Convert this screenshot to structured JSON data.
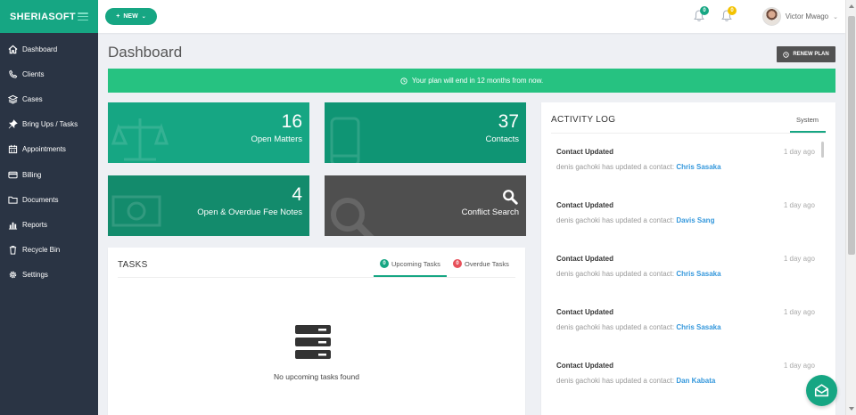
{
  "brand": "SHERIASOFT",
  "sidebar": {
    "items": [
      {
        "label": "Dashboard",
        "icon": "home-icon"
      },
      {
        "label": "Clients",
        "icon": "phone-icon"
      },
      {
        "label": "Cases",
        "icon": "layers-icon"
      },
      {
        "label": "Bring Ups / Tasks",
        "icon": "pin-icon"
      },
      {
        "label": "Appointments",
        "icon": "calendar-icon"
      },
      {
        "label": "Billing",
        "icon": "credit-card-icon"
      },
      {
        "label": "Documents",
        "icon": "folder-icon"
      },
      {
        "label": "Reports",
        "icon": "bar-chart-icon"
      },
      {
        "label": "Recycle Bin",
        "icon": "trash-icon"
      },
      {
        "label": "Settings",
        "icon": "gear-icon"
      }
    ]
  },
  "topbar": {
    "new_label": "NEW",
    "notifications_count": "0",
    "alerts_count": "0",
    "user_name": "Victor Mwago"
  },
  "page": {
    "title": "Dashboard",
    "renew_label": "RENEW PLAN",
    "plan_message": "Your plan will end in 12 months from now."
  },
  "stats": [
    {
      "value": "16",
      "label": "Open Matters",
      "color": "#16a683"
    },
    {
      "value": "37",
      "label": "Contacts",
      "color": "#0f9574"
    },
    {
      "value": "4",
      "label": "Open & Overdue Fee Notes",
      "color": "#138b6c"
    },
    {
      "value": "",
      "label": "Conflict Search",
      "color": "#4f4f4f"
    }
  ],
  "tasks": {
    "title": "TASKS",
    "upcoming_label": "Upcoming Tasks",
    "upcoming_count": "0",
    "overdue_label": "Overdue Tasks",
    "overdue_count": "0",
    "empty_message": "No upcoming tasks found"
  },
  "activity": {
    "title": "ACTIVITY LOG",
    "tab": "System",
    "items": [
      {
        "title": "Contact Updated",
        "time": "1 day ago",
        "text": "denis gachoki has updated a contact:",
        "who": "Chris Sasaka"
      },
      {
        "title": "Contact Updated",
        "time": "1 day ago",
        "text": "denis gachoki has updated a contact:",
        "who": "Davis Sang"
      },
      {
        "title": "Contact Updated",
        "time": "1 day ago",
        "text": "denis gachoki has updated a contact:",
        "who": "Chris Sasaka"
      },
      {
        "title": "Contact Updated",
        "time": "1 day ago",
        "text": "denis gachoki has updated a contact:",
        "who": "Chris Sasaka"
      },
      {
        "title": "Contact Updated",
        "time": "1 day ago",
        "text": "denis gachoki has updated a contact:",
        "who": "Dan Kabata"
      }
    ]
  },
  "colors": {
    "brand": "#16a683",
    "sidebar": "#2a3444",
    "plan_bar": "#26c281",
    "link": "#3598dc",
    "badge_green": "#16a683",
    "badge_yellow": "#f3c200",
    "badge_red": "#e7505a"
  }
}
